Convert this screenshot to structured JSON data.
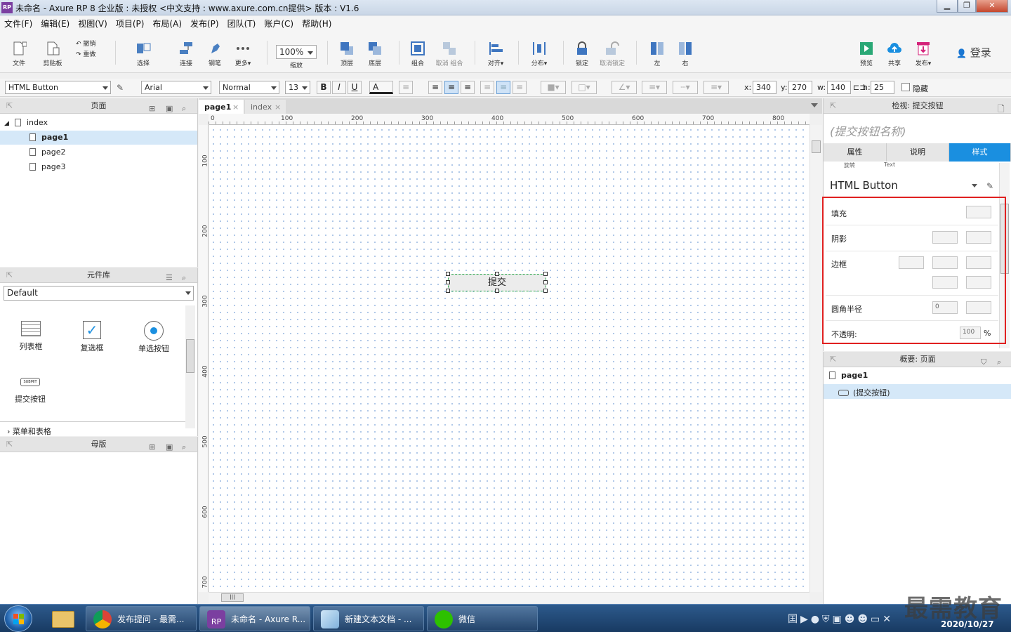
{
  "window": {
    "title": "未命名 - Axure RP 8 企业版 : 未授权      <中文支持 : www.axure.com.cn提供> 版本 : V1.6",
    "app_icon": "RP"
  },
  "menu": [
    "文件(F)",
    "编辑(E)",
    "视图(V)",
    "项目(P)",
    "布局(A)",
    "发布(P)",
    "团队(T)",
    "账户(C)",
    "帮助(H)"
  ],
  "toolbar": {
    "file": "文件",
    "clipboard": "剪贴板",
    "undo": "撤销",
    "redo": "重做",
    "select": "选择",
    "connect": "连接",
    "pen": "钢笔",
    "more": "更多▾",
    "zoom_value": "100%",
    "zoom_label": "缩放",
    "top": "顶层",
    "bottom": "底层",
    "group": "组合",
    "ungroup": "取消 组合",
    "align": "对齐▾",
    "distribute": "分布▾",
    "lock": "锁定",
    "unlock": "取消锁定",
    "left": "左",
    "right": "右",
    "preview": "预览",
    "share": "共享",
    "publish": "发布▾",
    "login": "登录"
  },
  "format": {
    "widget_type": "HTML Button",
    "font": "Arial",
    "weight": "Normal",
    "size": "13",
    "bold": "B",
    "italic": "I",
    "underline": "U",
    "color": "A",
    "x_label": "x:",
    "x": "340",
    "y_label": "y:",
    "y": "270",
    "w_label": "w:",
    "w": "140",
    "h_label": "h:",
    "h": "25",
    "hidden": "隐藏"
  },
  "pages_panel": {
    "title": "页面",
    "items": [
      {
        "label": "index"
      },
      {
        "label": "page1"
      },
      {
        "label": "page2"
      },
      {
        "label": "page3"
      }
    ]
  },
  "library_panel": {
    "title": "元件库",
    "library": "Default",
    "widgets": [
      "列表框",
      "复选框",
      "单选按钮",
      "提交按钮"
    ],
    "submit_icon_text": "SUBMIT",
    "section": "菜单和表格"
  },
  "masters_panel": {
    "title": "母版"
  },
  "tabs": [
    {
      "label": "page1"
    },
    {
      "label": "index"
    }
  ],
  "ruler": {
    "h_ticks": [
      "0",
      "100",
      "200",
      "300",
      "400",
      "500",
      "600",
      "700",
      "800"
    ],
    "v_ticks": [
      "100",
      "200",
      "300",
      "400",
      "500",
      "600",
      "700"
    ]
  },
  "canvas_widget": {
    "label": "提交"
  },
  "inspector": {
    "title": "检视: 提交按钮",
    "name_placeholder": "(提交按钮名称)",
    "tabs": [
      "属性",
      "说明",
      "样式"
    ],
    "sub_labels": [
      "旋转",
      "Text"
    ],
    "style_name": "HTML Button",
    "fill": "填充",
    "shadow": "阴影",
    "border": "边框",
    "radius": "圆角半径",
    "radius_value": "0",
    "opacity": "不透明:",
    "opacity_value": "100",
    "percent": "%"
  },
  "outline": {
    "title": "概要: 页面",
    "page": "page1",
    "item": "(提交按钮)"
  },
  "taskbar": {
    "tasks": [
      "发布提问 - 最需...",
      "未命名 - Axure R...",
      "新建文本文档 - ...",
      "微信"
    ],
    "date": "2020/10/27",
    "watermark": "最需教育"
  },
  "colors": {
    "accent": "#1a8fe0",
    "highlight": "#e02020",
    "selection": "#d5e8f8"
  }
}
